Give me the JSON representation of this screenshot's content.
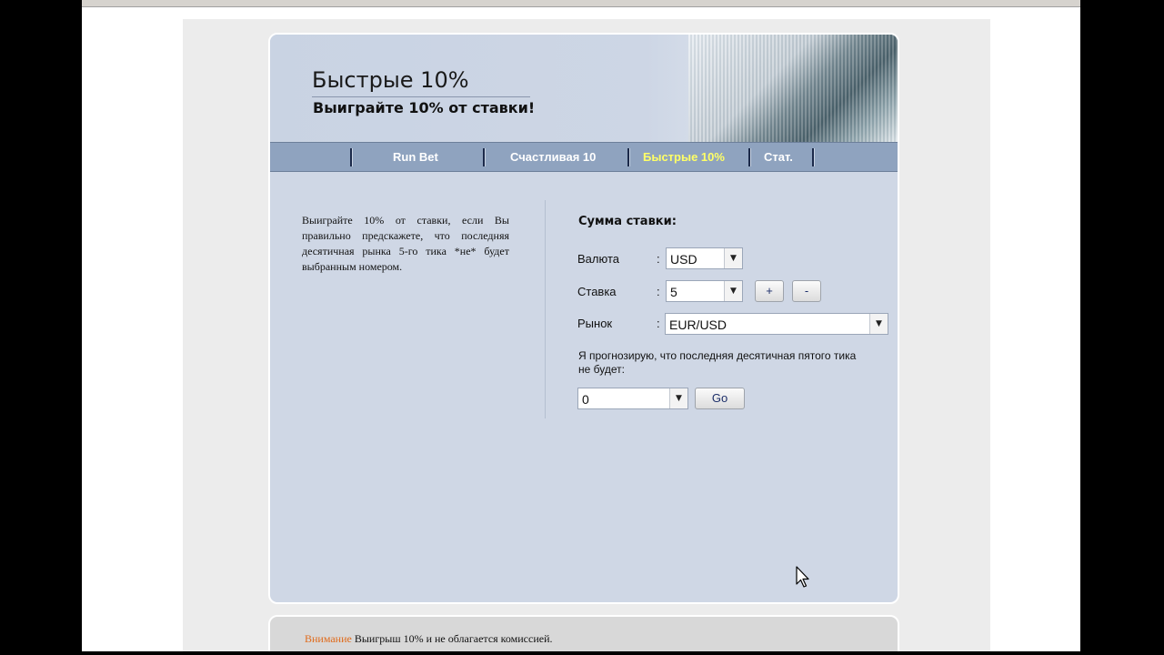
{
  "header": {
    "title": "Быстрые 10%",
    "subtitle": "Выиграйте 10% от ставки!"
  },
  "nav": {
    "items": [
      {
        "label": "Run Bet"
      },
      {
        "label": "Счастливая 10"
      },
      {
        "label": "Быстрые 10%"
      },
      {
        "label": "Стат."
      }
    ],
    "active_index": 2
  },
  "description": "Выиграйте 10% от ставки, если Вы правильно предскажете, что последняя десятичная рынка 5-го тика *не* будет выбранным номером.",
  "form": {
    "heading": "Сумма ставки:",
    "currency": {
      "label": "Валюта",
      "colon": ":",
      "value": "USD"
    },
    "stake": {
      "label": "Ставка",
      "colon": ":",
      "value": "5"
    },
    "plus_label": "+",
    "minus_label": "-",
    "market": {
      "label": "Рынок",
      "colon": ":",
      "value": "EUR/USD"
    },
    "prediction_hint": "Я прогнозирую, что последняя десятичная пятого тика не будет:",
    "digit": {
      "value": "0"
    },
    "go_label": "Go"
  },
  "footer": {
    "warning_label": "Внимание",
    "text": " Выигрыш 10% и не облагается комиссией."
  },
  "colors": {
    "panel_bg": "#cfd7e5",
    "nav_bg": "#8fa3bf",
    "nav_active": "#ffff66",
    "warning": "#e06a1a"
  }
}
